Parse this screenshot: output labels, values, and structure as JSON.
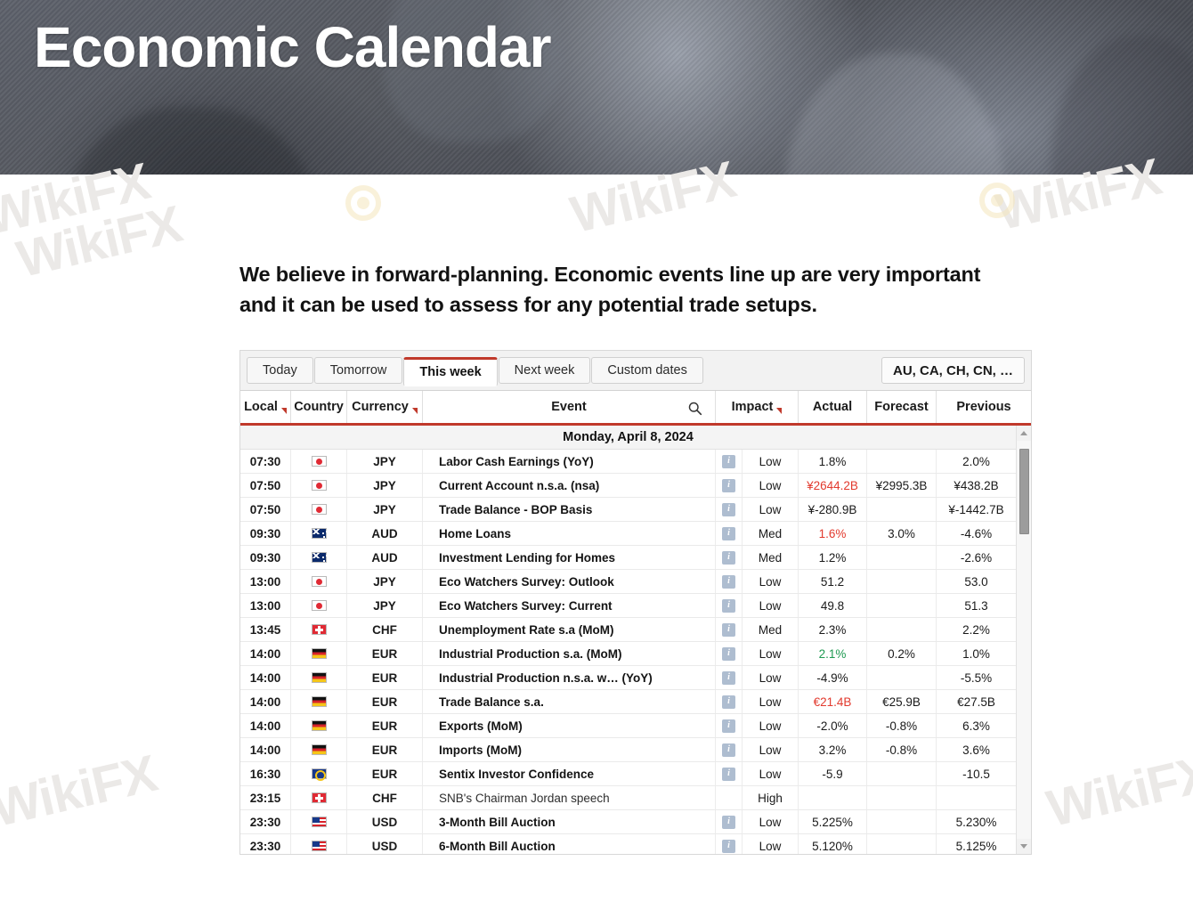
{
  "hero": {
    "title": "Economic Calendar"
  },
  "intro": {
    "text": "We believe in forward-planning. Economic events line up are very important and it can be used to assess for any potential trade setups."
  },
  "watermark": {
    "text": "WikiFX"
  },
  "calendar": {
    "tabs": [
      {
        "label": "Today",
        "active": false
      },
      {
        "label": "Tomorrow",
        "active": false
      },
      {
        "label": "This week",
        "active": true
      },
      {
        "label": "Next week",
        "active": false
      },
      {
        "label": "Custom dates",
        "active": false
      }
    ],
    "currency_filter": {
      "label": "AU, CA, CH, CN, …"
    },
    "columns": {
      "time": "Local",
      "country": "Country",
      "currency": "Currency",
      "event": "Event",
      "impact": "Impact",
      "actual": "Actual",
      "forecast": "Forecast",
      "previous": "Previous"
    },
    "date_group": "Monday, April 8, 2024",
    "rows": [
      {
        "time": "07:30",
        "flag": "jp",
        "currency": "JPY",
        "event": "Labor Cash Earnings (YoY)",
        "info": true,
        "impact": "Low",
        "actual": "1.8%",
        "actual_state": "none",
        "forecast": "",
        "previous": "2.0%"
      },
      {
        "time": "07:50",
        "flag": "jp",
        "currency": "JPY",
        "event": "Current Account n.s.a. (nsa)",
        "info": true,
        "impact": "Low",
        "actual": "¥2644.2B",
        "actual_state": "down",
        "forecast": "¥2995.3B",
        "previous": "¥438.2B"
      },
      {
        "time": "07:50",
        "flag": "jp",
        "currency": "JPY",
        "event": "Trade Balance - BOP Basis",
        "info": true,
        "impact": "Low",
        "actual": "¥-280.9B",
        "actual_state": "none",
        "forecast": "",
        "previous": "¥-1442.7B"
      },
      {
        "time": "09:30",
        "flag": "au",
        "currency": "AUD",
        "event": "Home Loans",
        "info": true,
        "impact": "Med",
        "actual": "1.6%",
        "actual_state": "down",
        "forecast": "3.0%",
        "previous": "-4.6%"
      },
      {
        "time": "09:30",
        "flag": "au",
        "currency": "AUD",
        "event": "Investment Lending for Homes",
        "info": true,
        "impact": "Med",
        "actual": "1.2%",
        "actual_state": "none",
        "forecast": "",
        "previous": "-2.6%"
      },
      {
        "time": "13:00",
        "flag": "jp",
        "currency": "JPY",
        "event": "Eco Watchers Survey: Outlook",
        "info": true,
        "impact": "Low",
        "actual": "51.2",
        "actual_state": "none",
        "forecast": "",
        "previous": "53.0"
      },
      {
        "time": "13:00",
        "flag": "jp",
        "currency": "JPY",
        "event": "Eco Watchers Survey: Current",
        "info": true,
        "impact": "Low",
        "actual": "49.8",
        "actual_state": "none",
        "forecast": "",
        "previous": "51.3"
      },
      {
        "time": "13:45",
        "flag": "ch",
        "currency": "CHF",
        "event": "Unemployment Rate s.a (MoM)",
        "info": true,
        "impact": "Med",
        "actual": "2.3%",
        "actual_state": "none",
        "forecast": "",
        "previous": "2.2%"
      },
      {
        "time": "14:00",
        "flag": "de",
        "currency": "EUR",
        "event": "Industrial Production s.a. (MoM)",
        "info": true,
        "impact": "Low",
        "actual": "2.1%",
        "actual_state": "up",
        "forecast": "0.2%",
        "previous": "1.0%"
      },
      {
        "time": "14:00",
        "flag": "de",
        "currency": "EUR",
        "event": "Industrial Production n.s.a. w… (YoY)",
        "info": true,
        "impact": "Low",
        "actual": "-4.9%",
        "actual_state": "none",
        "forecast": "",
        "previous": "-5.5%"
      },
      {
        "time": "14:00",
        "flag": "de",
        "currency": "EUR",
        "event": "Trade Balance s.a.",
        "info": true,
        "impact": "Low",
        "actual": "€21.4B",
        "actual_state": "down",
        "forecast": "€25.9B",
        "previous": "€27.5B"
      },
      {
        "time": "14:00",
        "flag": "de",
        "currency": "EUR",
        "event": "Exports (MoM)",
        "info": true,
        "impact": "Low",
        "actual": "-2.0%",
        "actual_state": "none",
        "forecast": "-0.8%",
        "previous": "6.3%"
      },
      {
        "time": "14:00",
        "flag": "de",
        "currency": "EUR",
        "event": "Imports (MoM)",
        "info": true,
        "impact": "Low",
        "actual": "3.2%",
        "actual_state": "none",
        "forecast": "-0.8%",
        "previous": "3.6%"
      },
      {
        "time": "16:30",
        "flag": "eu",
        "currency": "EUR",
        "event": "Sentix Investor Confidence",
        "info": true,
        "impact": "Low",
        "actual": "-5.9",
        "actual_state": "none",
        "forecast": "",
        "previous": "-10.5"
      },
      {
        "time": "23:15",
        "flag": "ch",
        "currency": "CHF",
        "event": "SNB's Chairman Jordan speech",
        "info": false,
        "impact": "High",
        "actual": "",
        "actual_state": "none",
        "forecast": "",
        "previous": "",
        "plain": true
      },
      {
        "time": "23:30",
        "flag": "us",
        "currency": "USD",
        "event": "3-Month Bill Auction",
        "info": true,
        "impact": "Low",
        "actual": "5.225%",
        "actual_state": "none",
        "forecast": "",
        "previous": "5.230%"
      },
      {
        "time": "23:30",
        "flag": "us",
        "currency": "USD",
        "event": "6-Month Bill Auction",
        "info": true,
        "impact": "Low",
        "actual": "5.120%",
        "actual_state": "none",
        "forecast": "",
        "previous": "5.125%"
      }
    ]
  },
  "colors": {
    "accent": "#c0392b",
    "up": "#1f9a52",
    "down": "#e23a2e",
    "info_badge": "#aebdd0"
  }
}
